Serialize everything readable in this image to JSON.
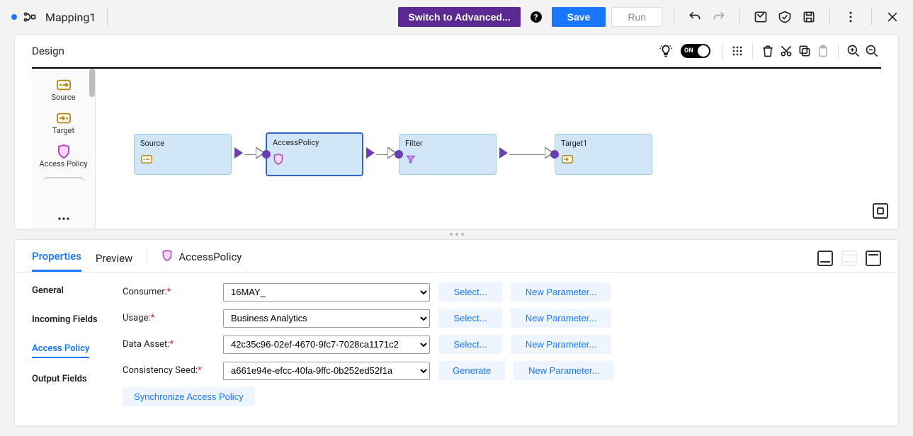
{
  "header": {
    "title": "Mapping1",
    "switch_btn": "Switch to Advanced...",
    "save_btn": "Save",
    "run_btn": "Run"
  },
  "design": {
    "title": "Design",
    "toggle_label": "ON",
    "palette": [
      {
        "label": "Source"
      },
      {
        "label": "Target"
      },
      {
        "label": "Access Policy"
      }
    ],
    "nodes": {
      "source": {
        "title": "Source"
      },
      "accesspolicy": {
        "title": "AccessPolicy"
      },
      "filter": {
        "title": "Filter"
      },
      "target1": {
        "title": "Target1"
      }
    }
  },
  "props": {
    "tab_properties": "Properties",
    "tab_preview": "Preview",
    "tx_name": "AccessPolicy",
    "side_nav": {
      "general": "General",
      "incoming": "Incoming Fields",
      "access_policy": "Access Policy",
      "output": "Output Fields"
    },
    "labels": {
      "consumer": "Consumer:",
      "usage": "Usage:",
      "data_asset": "Data Asset:",
      "seed": "Consistency Seed:"
    },
    "values": {
      "consumer": "16MAY_",
      "usage": "Business Analytics",
      "data_asset": "42c35c96-02ef-4670-9fc7-7028ca1171c2",
      "seed": "a661e94e-efcc-40fa-9ffc-0b252ed52f1a"
    },
    "buttons": {
      "select": "Select...",
      "new_param": "New Parameter...",
      "generate": "Generate",
      "sync": "Synchronize Access Policy"
    }
  }
}
